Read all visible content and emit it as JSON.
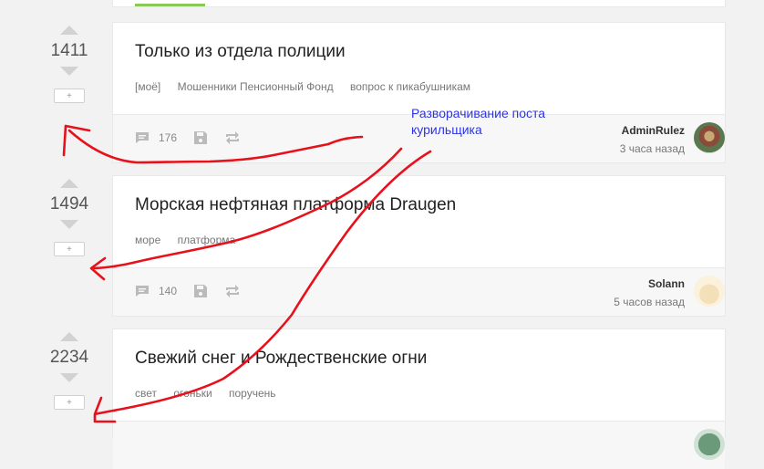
{
  "posts": [
    {
      "rating": "1411",
      "expand_label": "+",
      "title": "Только из отдела полиции",
      "tags": [
        "[моё]",
        "Мошенники Пенсионный Фонд",
        "вопрос к пикабушникам"
      ],
      "comments": "176",
      "author": "AdminRulez",
      "time": "3 часа назад"
    },
    {
      "rating": "1494",
      "expand_label": "+",
      "title": "Морская нефтяная платформа Draugen",
      "tags": [
        "море",
        "платформа"
      ],
      "comments": "140",
      "author": "Solann",
      "time": "5 часов назад"
    },
    {
      "rating": "2234",
      "expand_label": "+",
      "title": "Свежий снег и Рождественские огни",
      "tags": [
        "свет",
        "огоньки",
        "поручень"
      ]
    }
  ],
  "annotation": {
    "line1": "Разворачивание поста",
    "line2": "курильщика",
    "color": "#2e35e0"
  },
  "colors": {
    "accent": "#8ac858",
    "drawing": "#e8101a"
  }
}
